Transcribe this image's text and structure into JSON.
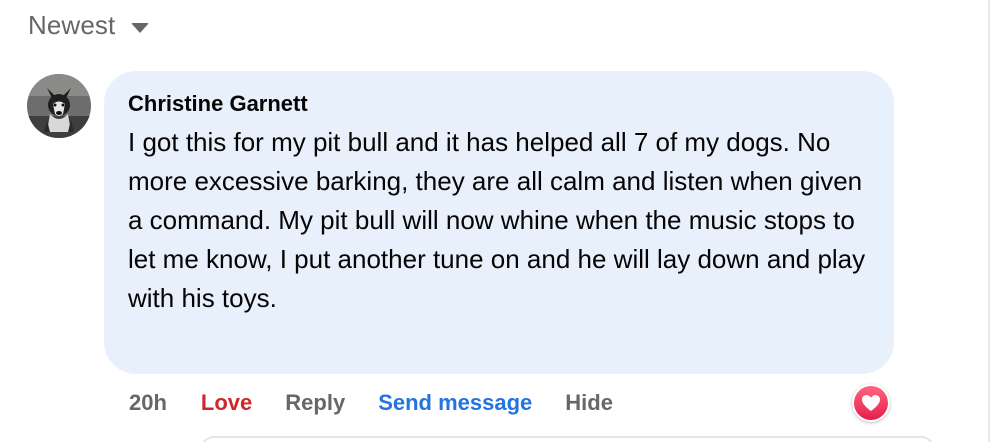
{
  "sort": {
    "label": "Newest",
    "caret_icon": "caret-down-icon"
  },
  "comment": {
    "author": "Christine Garnett",
    "text": "I got this for my pit bull and it has helped all 7 of my dogs. No more excessive barking, they are all calm and listen when given a command. My pit bull will now whine when the music stops to let me know, I put another tune on and he will lay down and play with his toys.",
    "avatar_icon": "dog-avatar",
    "bubble_color": "#e8f0fc"
  },
  "actions": {
    "time": "20h",
    "love": "Love",
    "reply": "Reply",
    "send_message": "Send message",
    "hide": "Hide",
    "love_color": "#d0272d",
    "link_color": "#2374e1"
  },
  "reaction": {
    "icon": "love-heart-icon"
  }
}
